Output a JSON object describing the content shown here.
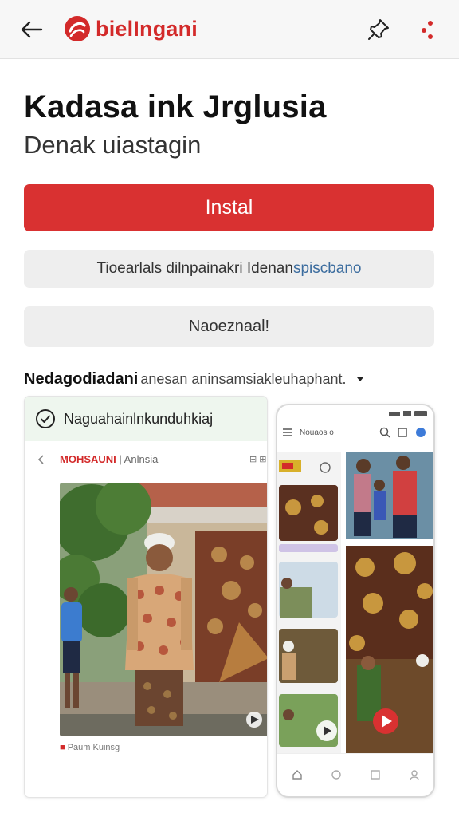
{
  "topbar": {
    "brand": "bielIngani",
    "brand_color": "#d32a2a",
    "icons": [
      "back-arrow-icon",
      "pin-icon",
      "more-options-icon"
    ]
  },
  "app": {
    "title": "Kadasa ink Jrglusia",
    "subtitle": "Denak uiastagin"
  },
  "buttons": {
    "install_label": "Instal",
    "install_color": "#d93131",
    "info_label_main": "Tioearlals dilnpainakri Idenan",
    "info_label_accent": "spiscbano",
    "secondary_label": "Naoeznaal!"
  },
  "section": {
    "title": "Nedagodiadani",
    "description": "anesan aninsamsiakleuhaphant."
  },
  "card_left": {
    "header_text": "Naguahainlnkunduhkiaj",
    "title_red": "MOHSAUNI",
    "title_gray": "Anlnsia",
    "menu_text": "⊟ ⊞",
    "caption_red": "■",
    "caption_text": "Paum Kuinsg"
  },
  "phone": {
    "header_text": "Nouaos o"
  }
}
